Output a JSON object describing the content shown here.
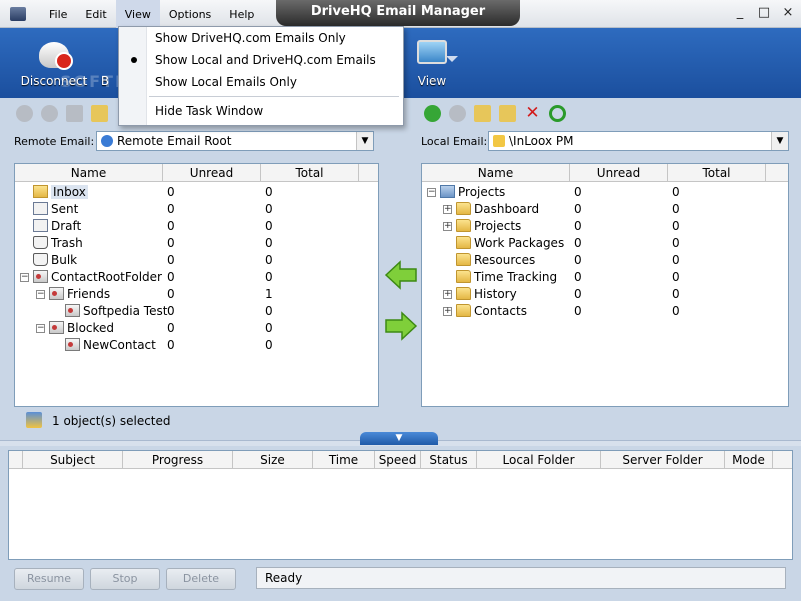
{
  "window": {
    "title": "DriveHQ Email Manager",
    "controls": [
      "_",
      "□",
      "×"
    ]
  },
  "menu": [
    "File",
    "Edit",
    "View",
    "Options",
    "Help"
  ],
  "toolbar": {
    "disconnect": "Disconnect",
    "view": "View",
    "partial_label": "B",
    "watermark": "SOFTPEDIA"
  },
  "view_menu": {
    "items": [
      {
        "label": "Show DriveHQ.com Emails Only",
        "checked": false
      },
      {
        "label": "Show Local and DriveHQ.com Emails",
        "checked": true
      },
      {
        "label": "Show Local Emails Only",
        "checked": false
      },
      {
        "label": "Hide Task Window",
        "checked": false
      }
    ]
  },
  "remote": {
    "label": "Remote Email:",
    "value": "Remote Email Root",
    "columns": [
      "Name",
      "Unread",
      "Total"
    ],
    "rows": [
      {
        "name": "Inbox",
        "unread": "0",
        "total": "0",
        "icon": "inbox-folder-icon",
        "level": 0,
        "expander": ""
      },
      {
        "name": "Sent",
        "unread": "0",
        "total": "0",
        "icon": "sent-mail-icon",
        "level": 0,
        "expander": ""
      },
      {
        "name": "Draft",
        "unread": "0",
        "total": "0",
        "icon": "draft-mail-icon",
        "level": 0,
        "expander": ""
      },
      {
        "name": "Trash",
        "unread": "0",
        "total": "0",
        "icon": "trash-icon",
        "level": 0,
        "expander": ""
      },
      {
        "name": "Bulk",
        "unread": "0",
        "total": "0",
        "icon": "bulk-trash-icon",
        "level": 0,
        "expander": ""
      },
      {
        "name": "ContactRootFolder",
        "unread": "0",
        "total": "0",
        "icon": "contact-icon",
        "level": 0,
        "expander": "−"
      },
      {
        "name": "Friends",
        "unread": "0",
        "total": "1",
        "icon": "contact-icon",
        "level": 1,
        "expander": "−"
      },
      {
        "name": "Softpedia Test",
        "unread": "0",
        "total": "0",
        "icon": "contact-icon",
        "level": 2,
        "expander": ""
      },
      {
        "name": "Blocked",
        "unread": "0",
        "total": "0",
        "icon": "contact-icon",
        "level": 1,
        "expander": "−"
      },
      {
        "name": "NewContact",
        "unread": "0",
        "total": "0",
        "icon": "contact-icon",
        "level": 2,
        "expander": ""
      }
    ]
  },
  "local": {
    "label": "Local Email:",
    "value": "\\InLoox PM",
    "columns": [
      "Name",
      "Unread",
      "Total"
    ],
    "rows": [
      {
        "name": "Projects",
        "unread": "0",
        "total": "0",
        "icon": "blue-folder-icon",
        "level": 0,
        "expander": "−"
      },
      {
        "name": "Dashboard",
        "unread": "0",
        "total": "0",
        "icon": "folder-icon",
        "level": 1,
        "expander": "+"
      },
      {
        "name": "Projects",
        "unread": "0",
        "total": "0",
        "icon": "folder-icon",
        "level": 1,
        "expander": "+"
      },
      {
        "name": "Work Packages",
        "unread": "0",
        "total": "0",
        "icon": "folder-icon",
        "level": 1,
        "expander": ""
      },
      {
        "name": "Resources",
        "unread": "0",
        "total": "0",
        "icon": "folder-icon",
        "level": 1,
        "expander": ""
      },
      {
        "name": "Time Tracking",
        "unread": "0",
        "total": "0",
        "icon": "folder-icon",
        "level": 1,
        "expander": ""
      },
      {
        "name": "History",
        "unread": "0",
        "total": "0",
        "icon": "folder-icon",
        "level": 1,
        "expander": "+"
      },
      {
        "name": "Contacts",
        "unread": "0",
        "total": "0",
        "icon": "folder-icon",
        "level": 1,
        "expander": "+"
      }
    ]
  },
  "status": {
    "selection": "1 object(s) selected",
    "ready": "Ready"
  },
  "transfer": {
    "columns": [
      "Subject",
      "Progress",
      "Size",
      "Time",
      "Speed",
      "Status",
      "Local Folder",
      "Server Folder",
      "Mode"
    ]
  },
  "buttons": {
    "resume": "Resume",
    "stop": "Stop",
    "delete": "Delete"
  }
}
